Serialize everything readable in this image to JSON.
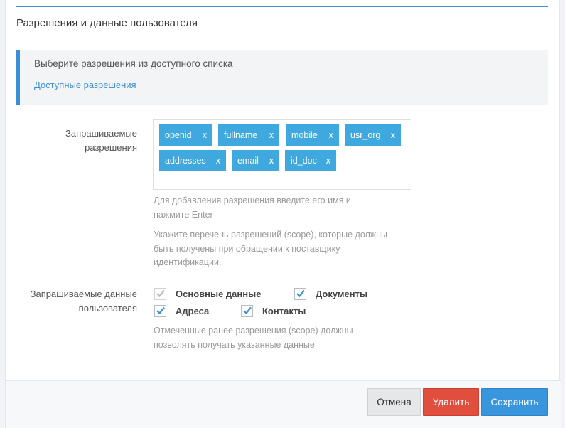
{
  "section": {
    "title": "Разрешения и данные пользователя"
  },
  "callout": {
    "text": "Выберите разрешения из доступного списка",
    "link": "Доступные разрешения"
  },
  "scopes": {
    "label_line1": "Запрашиваемые",
    "label_line2": "разрешения",
    "tags": [
      {
        "name": "openid",
        "remove": "x"
      },
      {
        "name": "fullname",
        "remove": "x"
      },
      {
        "name": "mobile",
        "remove": "x"
      },
      {
        "name": "usr_org",
        "remove": "x"
      },
      {
        "name": "addresses",
        "remove": "x"
      },
      {
        "name": "email",
        "remove": "x"
      },
      {
        "name": "id_doc",
        "remove": "x"
      }
    ],
    "help1_line1": "Для добавления разрешения введите его имя и",
    "help1_line2": "нажмите Enter",
    "help2_line1": "Укажите перечень разрешений (scope), которые должны",
    "help2_line2": "быть получены при обращении к поставщику",
    "help2_line3": "идентификации."
  },
  "userdata": {
    "label_line1": "Запрашиваемые данные",
    "label_line2": "пользователя",
    "options": [
      {
        "label": "Основные данные",
        "checked": true,
        "disabled": true
      },
      {
        "label": "Документы",
        "checked": true,
        "disabled": false
      },
      {
        "label": "Адреса",
        "checked": true,
        "disabled": false
      },
      {
        "label": "Контакты",
        "checked": true,
        "disabled": false
      }
    ],
    "help_line1": "Отмеченные ранее разрешения (scope) должны",
    "help_line2": "позволять получать указанные данные"
  },
  "footer": {
    "cancel_label": "Отмена",
    "delete_label": "Удалить",
    "save_label": "Сохранить"
  },
  "colors": {
    "accent": "#3a8fd6",
    "tag_bg": "#3fa9df",
    "delete": "#e04e3e",
    "save": "#3a96dc"
  }
}
